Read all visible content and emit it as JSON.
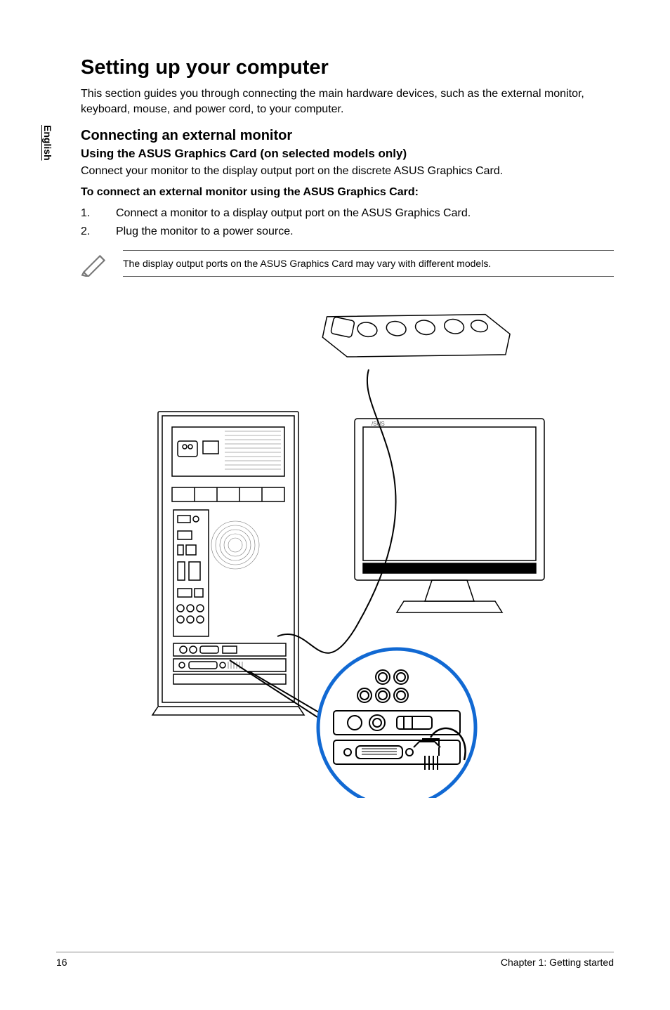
{
  "side_tab": {
    "label": "English"
  },
  "title": "Setting up your computer",
  "intro": "This section guides you through connecting the main hardware devices, such as the external monitor, keyboard, mouse, and power cord, to your computer.",
  "h2": "Connecting an external monitor",
  "h3": "Using the ASUS Graphics Card (on selected models only)",
  "body_text": "Connect your monitor to the display output port on the discrete ASUS Graphics Card.",
  "h4": "To connect an external monitor using the ASUS Graphics Card:",
  "steps": [
    {
      "num": "1.",
      "text": "Connect a monitor to a display output port on the ASUS Graphics Card."
    },
    {
      "num": "2.",
      "text": "Plug the monitor to a power source."
    }
  ],
  "note": "The display output ports on the ASUS Graphics Card may vary with different models.",
  "footer": {
    "page": "16",
    "chapter": "Chapter 1: Getting started"
  }
}
